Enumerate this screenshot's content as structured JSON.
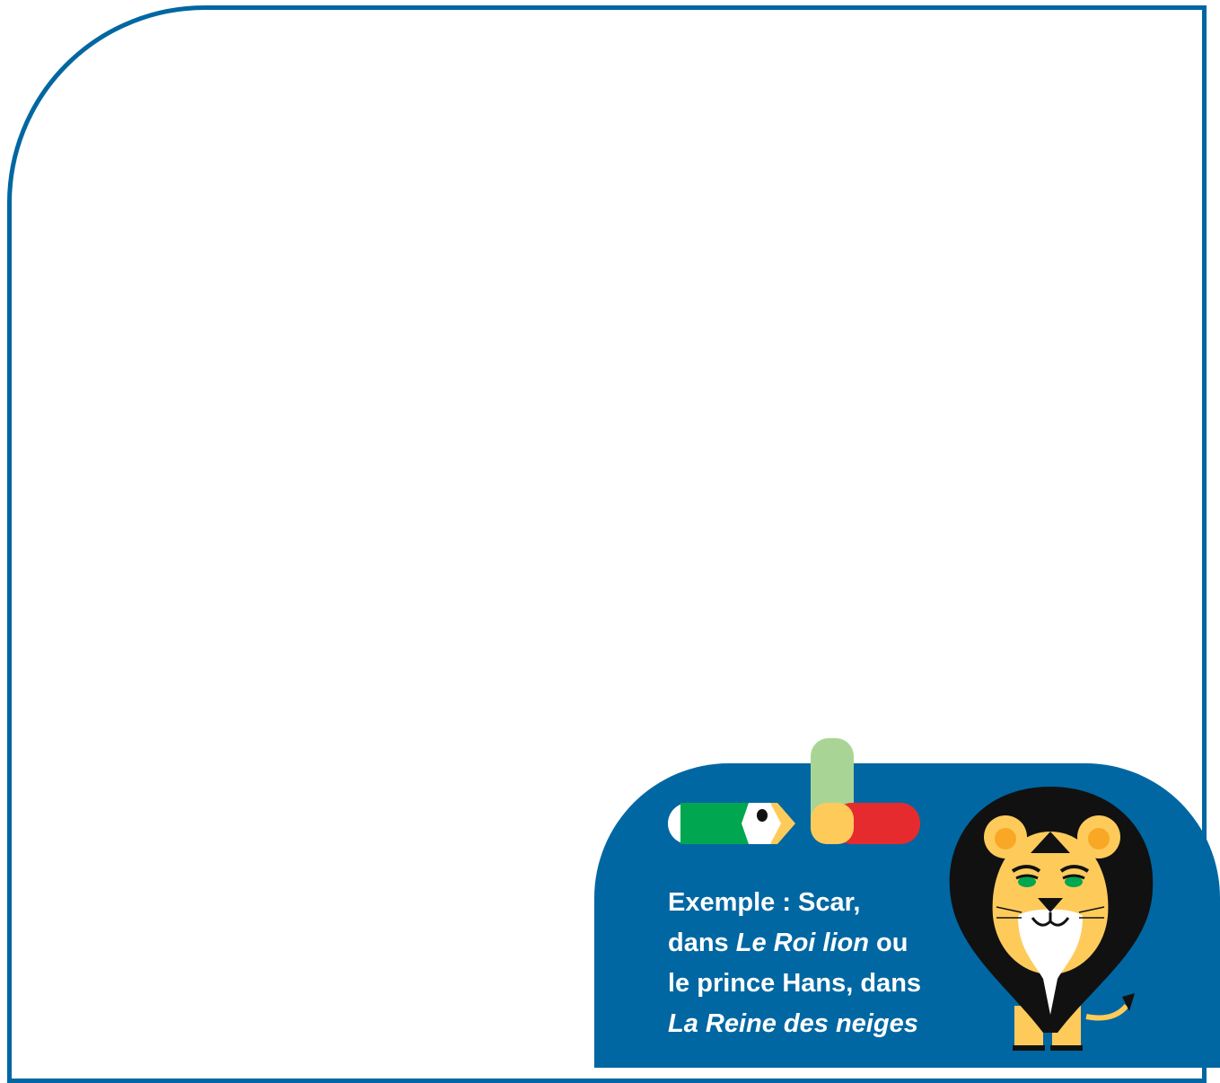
{
  "card": {
    "line1": "Exemple : Scar,",
    "line2_pre": "dans ",
    "line2_italic": "Le Roi lion",
    "line2_post": " ou",
    "line3": "le prince Hans, dans",
    "line4_italic": "La Reine des neiges"
  },
  "colors": {
    "frame": "#0067a2",
    "card_bg": "#0067a2",
    "pencil_green": "#00a650",
    "pencil_tip": "#fecb5b",
    "bar_light_green": "#a8d595",
    "bar_red": "#e62b2e"
  },
  "icons": [
    "pencil-icon",
    "logo-bars-icon",
    "lion-illustration"
  ]
}
